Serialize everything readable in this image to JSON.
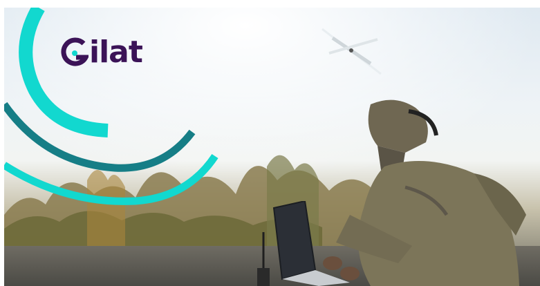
{
  "brand": {
    "name": "ilat",
    "colors": {
      "wordmark": "#3b1357",
      "arc_cyan": "#12d8cf",
      "arc_teal": "#167e86"
    }
  },
  "scene": {
    "icons": [
      "drone-icon",
      "laptop-icon",
      "radio-antenna-icon"
    ]
  }
}
